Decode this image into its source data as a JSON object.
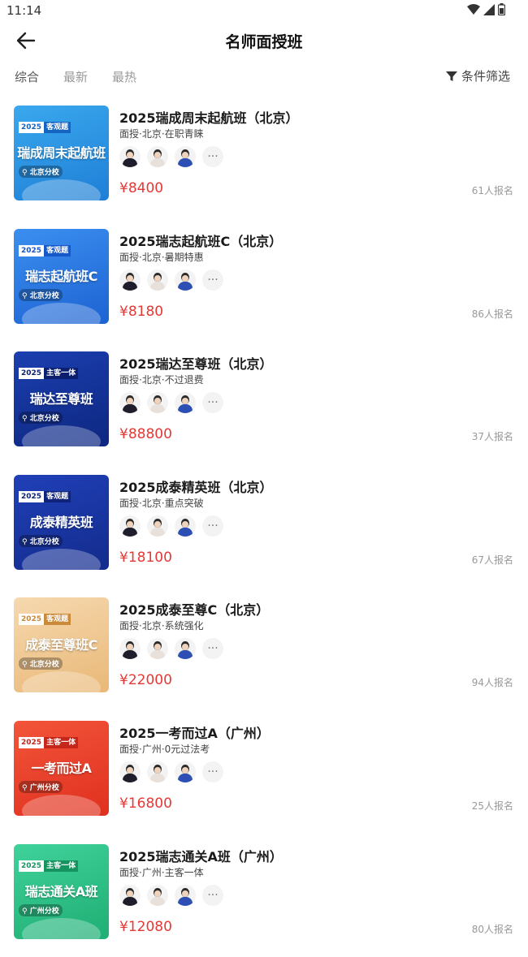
{
  "status_bar": {
    "time": "11:14"
  },
  "nav": {
    "title": "名师面授班",
    "back_icon": "arrow-left-icon"
  },
  "sort_tabs": [
    {
      "label": "综合",
      "active": true
    },
    {
      "label": "最新",
      "active": false
    },
    {
      "label": "最热",
      "active": false
    }
  ],
  "filter": {
    "label": "条件筛选",
    "icon": "funnel-icon"
  },
  "colors": {
    "price": "#e53935",
    "enroll": "#999999"
  },
  "courses": [
    {
      "title": "2025瑞成周末起航班（北京）",
      "subtitle": "面授·北京·在职青睐",
      "price": "¥8400",
      "enrolled": "61人报名",
      "cover": {
        "year": "2025",
        "kind": "客观题",
        "name": "瑞成周末起航班",
        "campus": "北京分校",
        "bg": "#3aa8ee",
        "bg2": "#1f7fd6",
        "kind_bg": "#1565c0"
      }
    },
    {
      "title": "2025瑞志起航班C（北京）",
      "subtitle": "面授·北京·暑期特惠",
      "price": "¥8180",
      "enrolled": "86人报名",
      "cover": {
        "year": "2025",
        "kind": "客观题",
        "name": "瑞志起航班C",
        "campus": "北京分校",
        "bg": "#3b8ff0",
        "bg2": "#1d63d2",
        "kind_bg": "#1558c7"
      }
    },
    {
      "title": "2025瑞达至尊班（北京）",
      "subtitle": "面授·北京·不过退费",
      "price": "¥88800",
      "enrolled": "37人报名",
      "cover": {
        "year": "2025",
        "kind": "主客一体",
        "name": "瑞达至尊班",
        "campus": "北京分校",
        "bg": "#1c3fb0",
        "bg2": "#0d2780",
        "kind_bg": "#0b1f6e"
      }
    },
    {
      "title": "2025成泰精英班（北京）",
      "subtitle": "面授·北京·重点突破",
      "price": "¥18100",
      "enrolled": "67人报名",
      "cover": {
        "year": "2025",
        "kind": "客观题",
        "name": "成泰精英班",
        "campus": "北京分校",
        "bg": "#2040b8",
        "bg2": "#132b8c",
        "kind_bg": "#0f237a"
      }
    },
    {
      "title": "2025成泰至尊C（北京）",
      "subtitle": "面授·北京·系统强化",
      "price": "¥22000",
      "enrolled": "94人报名",
      "cover": {
        "year": "2025",
        "kind": "客观题",
        "name": "成泰至尊班C",
        "campus": "北京分校",
        "bg": "#f6d9b0",
        "bg2": "#e9b877",
        "kind_bg": "#c98a3a"
      }
    },
    {
      "title": "2025一考而过A（广州）",
      "subtitle": "面授·广州·0元过法考",
      "price": "¥16800",
      "enrolled": "25人报名",
      "cover": {
        "year": "2025",
        "kind": "主客一体",
        "name": "一考而过A",
        "campus": "广州分校",
        "bg": "#f2553a",
        "bg2": "#e0301f",
        "kind_bg": "#c4261a"
      }
    },
    {
      "title": "2025瑞志通关A班（广州）",
      "subtitle": "面授·广州·主客一体",
      "price": "¥12080",
      "enrolled": "80人报名",
      "cover": {
        "year": "2025",
        "kind": "主客一体",
        "name": "瑞志通关A班",
        "campus": "广州分校",
        "bg": "#3fd29a",
        "bg2": "#1fae74",
        "kind_bg": "#17935f"
      }
    }
  ],
  "teacher_avatars": [
    {
      "name": "teacher-avatar-1",
      "suit": "#1d1d2b"
    },
    {
      "name": "teacher-avatar-2",
      "suit": "#e8e0da"
    },
    {
      "name": "teacher-avatar-3",
      "suit": "#2d4fb3"
    }
  ],
  "more_label": "···"
}
